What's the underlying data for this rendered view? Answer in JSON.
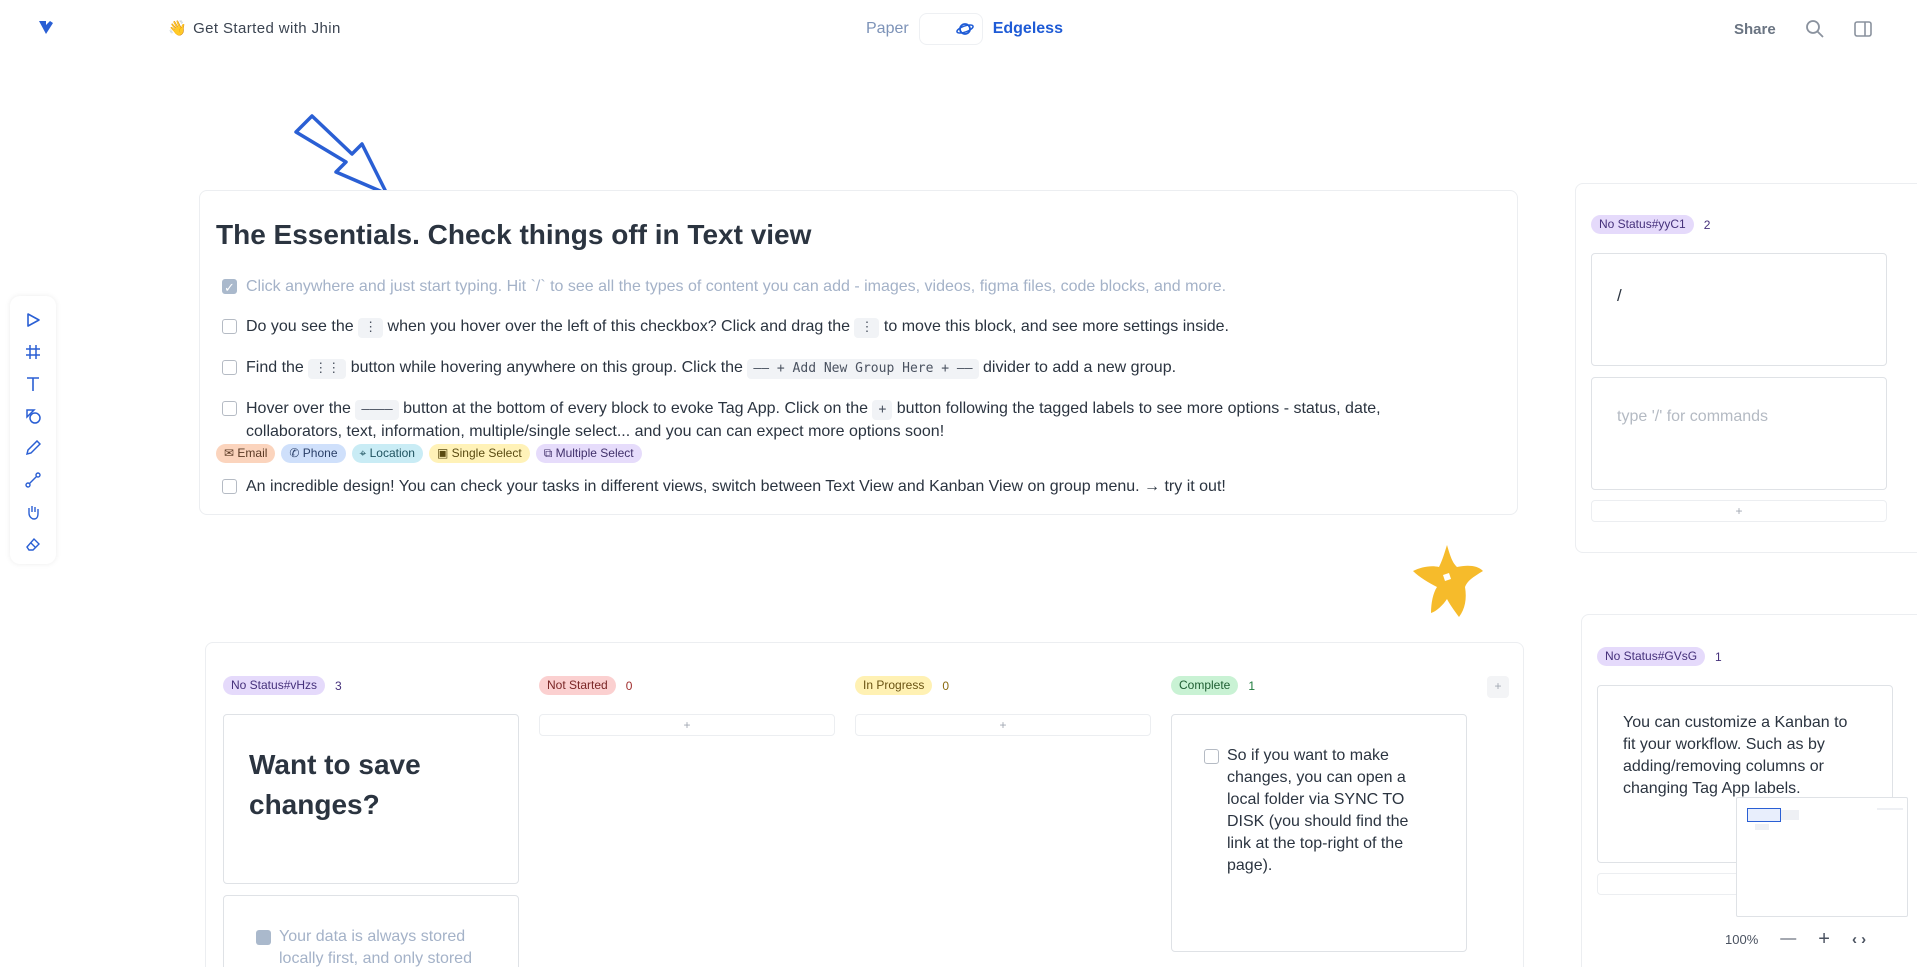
{
  "header": {
    "title_emoji": "👋",
    "title": "Get Started with Jhin",
    "mode_paper": "Paper",
    "mode_edgeless": "Edgeless",
    "share": "Share"
  },
  "toolbar": {
    "tools": [
      "select-icon",
      "frame-icon",
      "text-icon",
      "shape-icon",
      "pen-icon",
      "connector-icon",
      "hand-icon",
      "eraser-icon"
    ]
  },
  "essentials": {
    "title": "The Essentials. Check things off in Text view",
    "tasks": [
      {
        "checked": true,
        "parts": [
          "Click anywhere and just start typing. Hit `/` to see all the types of content you can add - images, videos, figma files, code blocks, and more."
        ]
      },
      {
        "checked": false,
        "p1": "Do you see the",
        "chip1": "⋮",
        "p2": "when you hover over the left of this checkbox? Click and drag the",
        "chip2": "⋮",
        "p3": "to move this block, and see more settings inside."
      },
      {
        "checked": false,
        "p1": "Find the",
        "chip1": "⋮⋮",
        "p2": "button while hovering anywhere on this group. Click the",
        "chip2": "—— + Add New Group Here + ——",
        "p3": "divider to add a new group."
      },
      {
        "checked": false,
        "p1": "Hover over the",
        "chip1": "————",
        "p2": "button at the bottom of every block to evoke Tag App. Click on the",
        "chip2": "+",
        "p3": "button following the tagged labels to see more options - status, date,",
        "line2": "collaborators, text, information, multiple/single select... and you can can expect more options soon!"
      },
      {
        "checked": false,
        "text": "An incredible design! You can check your tasks in different views, switch between Text View and Kanban View on group menu. → try it out!"
      }
    ],
    "tags": [
      "Email",
      "Phone",
      "Location",
      "Single Select",
      "Multiple Select"
    ]
  },
  "board": {
    "columns": [
      {
        "status": "No Status#vHzs",
        "count": "3"
      },
      {
        "status": "Not Started",
        "count": "0"
      },
      {
        "status": "In Progress",
        "count": "0"
      },
      {
        "status": "Complete",
        "count": "1"
      }
    ],
    "card_heading": "Want to save changes?",
    "card_checked_text": "Your data is always stored locally first, and only stored",
    "complete_card_text": "So if you want to make changes, you can open a local folder via SYNC TO DISK (you should find the link at the top-right of the page).",
    "add": "+"
  },
  "right1": {
    "status": "No Status#yyC1",
    "count": "2",
    "card1_text": "/",
    "card2_placeholder": "type '/' for commands",
    "add": "+"
  },
  "right2": {
    "status": "No Status#GVsG",
    "count": "1",
    "card_text": "You can customize a Kanban to fit your workflow. Such as by adding/removing columns or changing Tag App labels."
  },
  "zoom": {
    "level": "100%",
    "minus": "—",
    "plus": "+",
    "fit": "‹ ›"
  },
  "colors": {
    "accent": "#1e5bd6",
    "star": "#f6bb2b",
    "arrow": "#2a5fd4"
  }
}
